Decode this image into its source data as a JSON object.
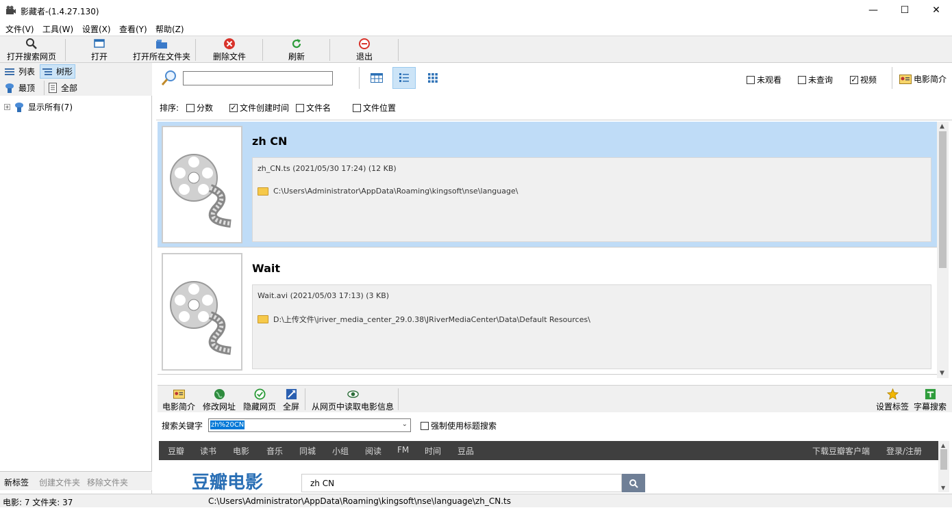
{
  "window": {
    "title": "影藏者-(1.4.27.130)",
    "minimize": "—",
    "maximize": "☐",
    "close": "✕"
  },
  "menu": [
    "文件(V)",
    "工具(W)",
    "设置(X)",
    "查看(Y)",
    "帮助(Z)"
  ],
  "toolbar": {
    "open_search_web": "打开搜索网页",
    "open": "打开",
    "open_folder": "打开所在文件夹",
    "delete_file": "删除文件",
    "refresh": "刷新",
    "exit": "退出"
  },
  "left": {
    "list_label": "列表",
    "tree_label": "树形",
    "top_label": "最顶",
    "all_label": "全部",
    "tree_root": "显示所有(7)",
    "new_tag": "新标签",
    "create_folder": "创建文件夹",
    "remove_folder": "移除文件夹"
  },
  "filters": {
    "unwatched": "未观看",
    "unqueried": "未查询",
    "video": "视频",
    "movie_intro": "电影简介",
    "sort_label": "排序:",
    "sort_score": "分数",
    "sort_created": "文件创建时间",
    "sort_filename": "文件名",
    "sort_location": "文件位置"
  },
  "items": [
    {
      "title": "zh CN",
      "file": "zh_CN.ts (2021/05/30 17:24)   (12 KB)",
      "path": "C:\\Users\\Administrator\\AppData\\Roaming\\kingsoft\\nse\\language\\"
    },
    {
      "title": "Wait",
      "file": "Wait.avi (2021/05/03 17:13)   (3 KB)",
      "path": "D:\\上传文件\\jriver_media_center_29.0.38\\JRiverMediaCenter\\Data\\Default Resources\\"
    }
  ],
  "bottom_toolbar": {
    "movie_intro": "电影简介",
    "edit_url": "修改网址",
    "hide_web": "隐藏网页",
    "fullscreen": "全屏",
    "read_info": "从网页中读取电影信息",
    "set_tag": "设置标签",
    "subtitle_search": "字幕搜索"
  },
  "keyword": {
    "label": "搜索关键字",
    "value": "zh%20CN",
    "force_title": "强制使用标题搜索"
  },
  "web": {
    "nav": [
      "豆瓣",
      "读书",
      "电影",
      "音乐",
      "同城",
      "小组",
      "阅读",
      "FM",
      "时间",
      "豆品"
    ],
    "download_client": "下载豆瓣客户端",
    "login": "登录/注册",
    "logo": "豆瓣电影",
    "search_value": "zh CN"
  },
  "status": {
    "counts": "电影: 7 文件夹: 37",
    "path": "C:\\Users\\Administrator\\AppData\\Roaming\\kingsoft\\nse\\language\\zh_CN.ts"
  },
  "colors": {
    "selected": "#bfdcf7",
    "toolbar": "#f0f0f0",
    "webnav": "#3f3f3f",
    "douban_green": "#2e963d"
  }
}
